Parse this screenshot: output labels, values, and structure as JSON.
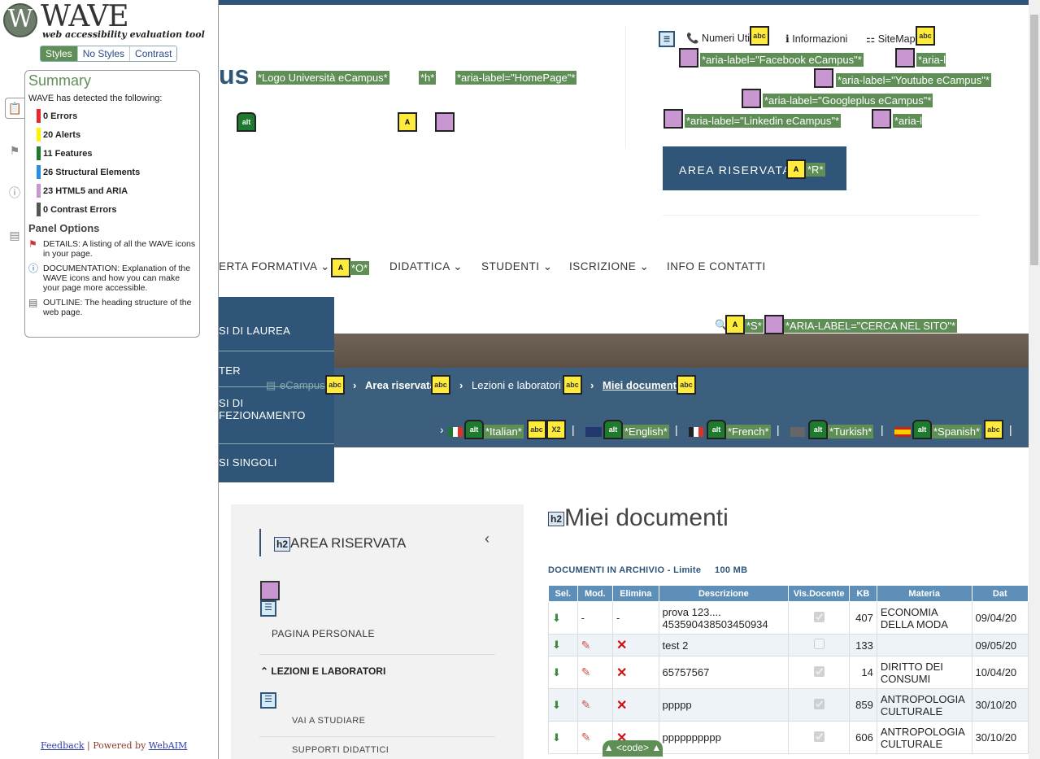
{
  "wave": {
    "logo_letter": "W",
    "title": "WAVE",
    "subtitle": "web accessibility evaluation tool",
    "view_modes": [
      "Styles",
      "No Styles",
      "Contrast"
    ],
    "summary_title": "Summary",
    "detected_text": "WAVE has detected the following:",
    "counts": [
      {
        "label": "0 Errors",
        "color": "#e8262b"
      },
      {
        "label": "20 Alerts",
        "color": "#fff200"
      },
      {
        "label": "11 Features",
        "color": "#1e7a2e"
      },
      {
        "label": "26 Structural Elements",
        "color": "#2b8de0"
      },
      {
        "label": "23 HTML5 and ARIA",
        "color": "#c896d0"
      },
      {
        "label": "0 Contrast Errors",
        "color": "#555555"
      }
    ],
    "panel_options_title": "Panel Options",
    "options": [
      {
        "text": "DETAILS: A listing of all the WAVE icons in your page."
      },
      {
        "text": "DOCUMENTATION: Explanation of the WAVE icons and how you can make your page more accessible."
      },
      {
        "text": "OUTLINE: The heading structure of the web page."
      }
    ],
    "feedback": "Feedback",
    "separator": " | Powered by ",
    "webaim": "WebAIM",
    "code_toggle": "▲ <code> ▲"
  },
  "header": {
    "logo_partial": "us",
    "labels": {
      "logo": "*Logo Università eCampus*",
      "h": "*h*",
      "homepage": "*aria-label=\"HomePage\"*"
    },
    "utility": [
      "Numeri Utili",
      "Informazioni",
      "SiteMap"
    ],
    "social_labels": [
      "*aria-label=\"Facebook eCampus\"*",
      "*aria-label=\"Twitter eCampus\"*",
      "*aria-label=\"Youtube eCampus\"*",
      "*aria-label=\"Googleplus eCampus\"*",
      "*aria-label=\"Linkedin eCampus\"*",
      "*aria-label=\"Instagram eCampus\"*"
    ],
    "area_riservata": "AREA RISERVATA",
    "r_label": "*R*"
  },
  "nav": {
    "items": [
      "ERTA FORMATIVA",
      "DIDATTICA",
      "STUDENTI",
      "ISCRIZIONE",
      "INFO E CONTATTI"
    ],
    "o_label": "*O*",
    "search_labels": [
      "*S*",
      "*ARIA-LABEL=\"CERCA NEL SITO\"*"
    ]
  },
  "dropdown": [
    "SI DI LAUREA",
    "TER",
    "SI DI FEZIONAMENTO",
    "SI SINGOLI"
  ],
  "breadcrumb": [
    "eCampus",
    "Area riservata",
    "Lezioni e laboratori",
    "Miei documenti"
  ],
  "languages": [
    "*Italian*",
    "*English*",
    "*French*",
    "*Turkish*",
    "*Spanish*"
  ],
  "sidenav": {
    "title": "AREA RISERVATA",
    "items": [
      "PAGINA PERSONALE",
      "LEZIONI E LABORATORI",
      "VAI A STUDIARE",
      "SUPPORTI DIDATTICI"
    ]
  },
  "main": {
    "title": "Miei documenti",
    "limit_label": "DOCUMENTI IN ARCHIVIO - Limite",
    "limit_value": "100 MB",
    "columns": [
      "Sel.",
      "Mod.",
      "Elimina",
      "Descrizione",
      "Vis.Docente",
      "KB",
      "Materia",
      "Dat"
    ],
    "rows": [
      {
        "mod": "-",
        "del": "-",
        "desc": "prova 123.... 453590438503450934",
        "vis": true,
        "kb": "407",
        "materia": "ECONOMIA DELLA MODA",
        "data": "09/04/20"
      },
      {
        "mod": "edit",
        "del": "x",
        "desc": "test 2",
        "vis": false,
        "kb": "133",
        "materia": "",
        "data": "09/05/20"
      },
      {
        "mod": "edit",
        "del": "x",
        "desc": "65757567",
        "vis": true,
        "kb": "14",
        "materia": "DIRITTO DEI CONSUMI",
        "data": "10/04/20"
      },
      {
        "mod": "edit",
        "del": "x",
        "desc": "ppppp",
        "vis": true,
        "kb": "859",
        "materia": "ANTROPOLOGIA CULTURALE",
        "data": "30/10/20"
      },
      {
        "mod": "edit",
        "del": "x",
        "desc": "pppppppppp",
        "vis": true,
        "kb": "606",
        "materia": "ANTROPOLOGIA CULTURALE",
        "data": "30/10/20"
      }
    ]
  }
}
